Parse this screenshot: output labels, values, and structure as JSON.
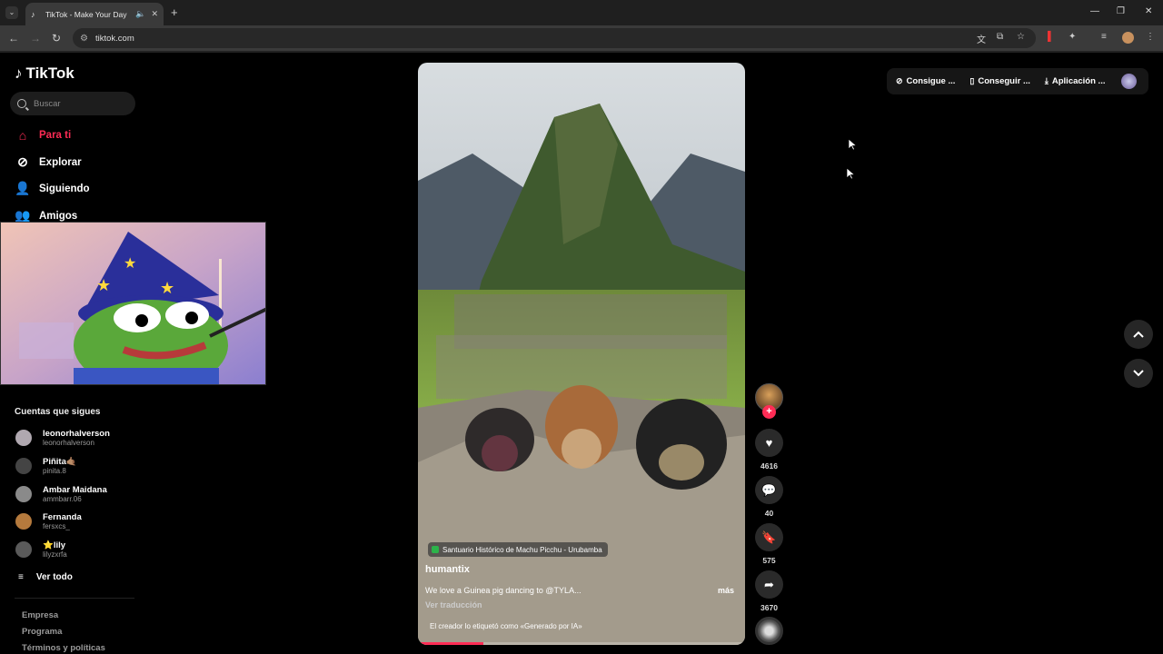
{
  "browser": {
    "tab_title": "TikTok - Make Your Day",
    "url": "tiktok.com",
    "tab_icons": [
      "audio-icon",
      "close-icon"
    ]
  },
  "sidebar": {
    "logo": "TikTok",
    "search_placeholder": "Buscar",
    "nav": [
      {
        "label": "Para ti",
        "icon": "home-icon",
        "active": true
      },
      {
        "label": "Explorar",
        "icon": "compass-icon"
      },
      {
        "label": "Siguiendo",
        "icon": "following-icon"
      },
      {
        "label": "Amigos",
        "icon": "friends-icon"
      }
    ],
    "following_title": "Cuentas que sigues",
    "accounts": [
      {
        "name": "leonorhalverson",
        "handle": "leonorhalverson",
        "color": "#b0a8b0"
      },
      {
        "name": "Piñita🤙🏽",
        "handle": "pinita.8",
        "color": "#444444"
      },
      {
        "name": "Ambar Maidana",
        "handle": "ammbarr.06",
        "color": "#8a8a8a"
      },
      {
        "name": "Fernanda",
        "handle": "fersxcs_",
        "color": "#b57a3d"
      },
      {
        "name": "⭐lily",
        "handle": "lilyzxrfa",
        "color": "#5a5a5a"
      }
    ],
    "see_all": "Ver todo",
    "footer": [
      "Empresa",
      "Programa",
      "Términos y políticas"
    ]
  },
  "video": {
    "location": "Santuario Histórico de Machu Picchu - Urubamba",
    "author": "humantix",
    "caption": "We love a Guinea pig dancing to @TYLA...",
    "more": "más",
    "translate": "Ver traducción",
    "ai_label": "El creador lo etiquetó como «Generado por IA»",
    "progress": 0.2
  },
  "actions": {
    "follow": "+",
    "likes": "4616",
    "comments": "40",
    "saves": "575",
    "shares": "3670"
  },
  "topbar": {
    "coins": "Consigue ...",
    "get_app": "Conseguir ...",
    "app": "Aplicación ..."
  },
  "colors": {
    "accent": "#fe2c55",
    "background": "#000000"
  }
}
